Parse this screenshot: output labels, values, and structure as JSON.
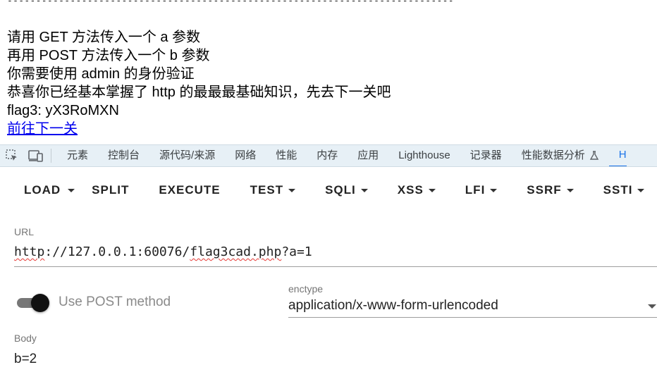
{
  "page": {
    "separator": "------------------------------------------------------------------------------",
    "lines": [
      "请用 GET 方法传入一个 a 参数",
      "再用 POST 方法传入一个 b 参数",
      "你需要使用 admin 的身份验证",
      "恭喜你已经基本掌握了 http 的最最最基础知识，先去下一关吧",
      "flag3: yX3RoMXN"
    ],
    "next_link": "前往下一关"
  },
  "devtools": {
    "tool_icons": [
      "element-picker-icon",
      "device-toolbar-icon"
    ],
    "tabs": [
      "元素",
      "控制台",
      "源代码/来源",
      "网络",
      "性能",
      "内存",
      "应用",
      "Lighthouse",
      "记录器",
      "性能数据分析"
    ],
    "last_tab": "H"
  },
  "hackbar": {
    "load": "LOAD",
    "split": "SPLIT",
    "execute": "EXECUTE",
    "menus": [
      "TEST",
      "SQLI",
      "XSS",
      "LFI",
      "SSRF",
      "SSTI"
    ],
    "url_label": "URL",
    "url_parts": {
      "p1": "http",
      "p2": "://127.0.0.1:60076/",
      "p3": "flag3cad.php",
      "p4": "?a=1"
    },
    "post_label": "Use POST method",
    "post_enabled": true,
    "enctype_label": "enctype",
    "enctype_value": "application/x-www-form-urlencoded",
    "body_label": "Body",
    "body_value": "b=2"
  }
}
